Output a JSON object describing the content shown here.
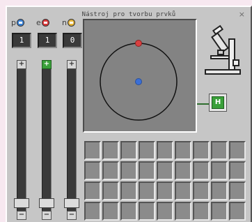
{
  "window": {
    "title": "Nástroj pro tvorbu prvků",
    "close_glyph": "×"
  },
  "particles": [
    {
      "key": "protons",
      "label": "p",
      "color": "#3b82d6",
      "count": "1"
    },
    {
      "key": "electrons",
      "label": "e",
      "color": "#d9383a",
      "count": "1"
    },
    {
      "key": "neutrons",
      "label": "n",
      "color": "#e4b43a",
      "count": "0"
    }
  ],
  "slider_buttons": {
    "plus": "+",
    "minus": "−"
  },
  "atom": {
    "nucleus_color": "#3b6fd6",
    "electron_color": "#d94040",
    "orbit_color": "#111111"
  },
  "element_output": {
    "symbol": "H",
    "color": "#3aa03a"
  },
  "icons": {
    "microscope": "microscope-icon",
    "close": "close-icon"
  }
}
